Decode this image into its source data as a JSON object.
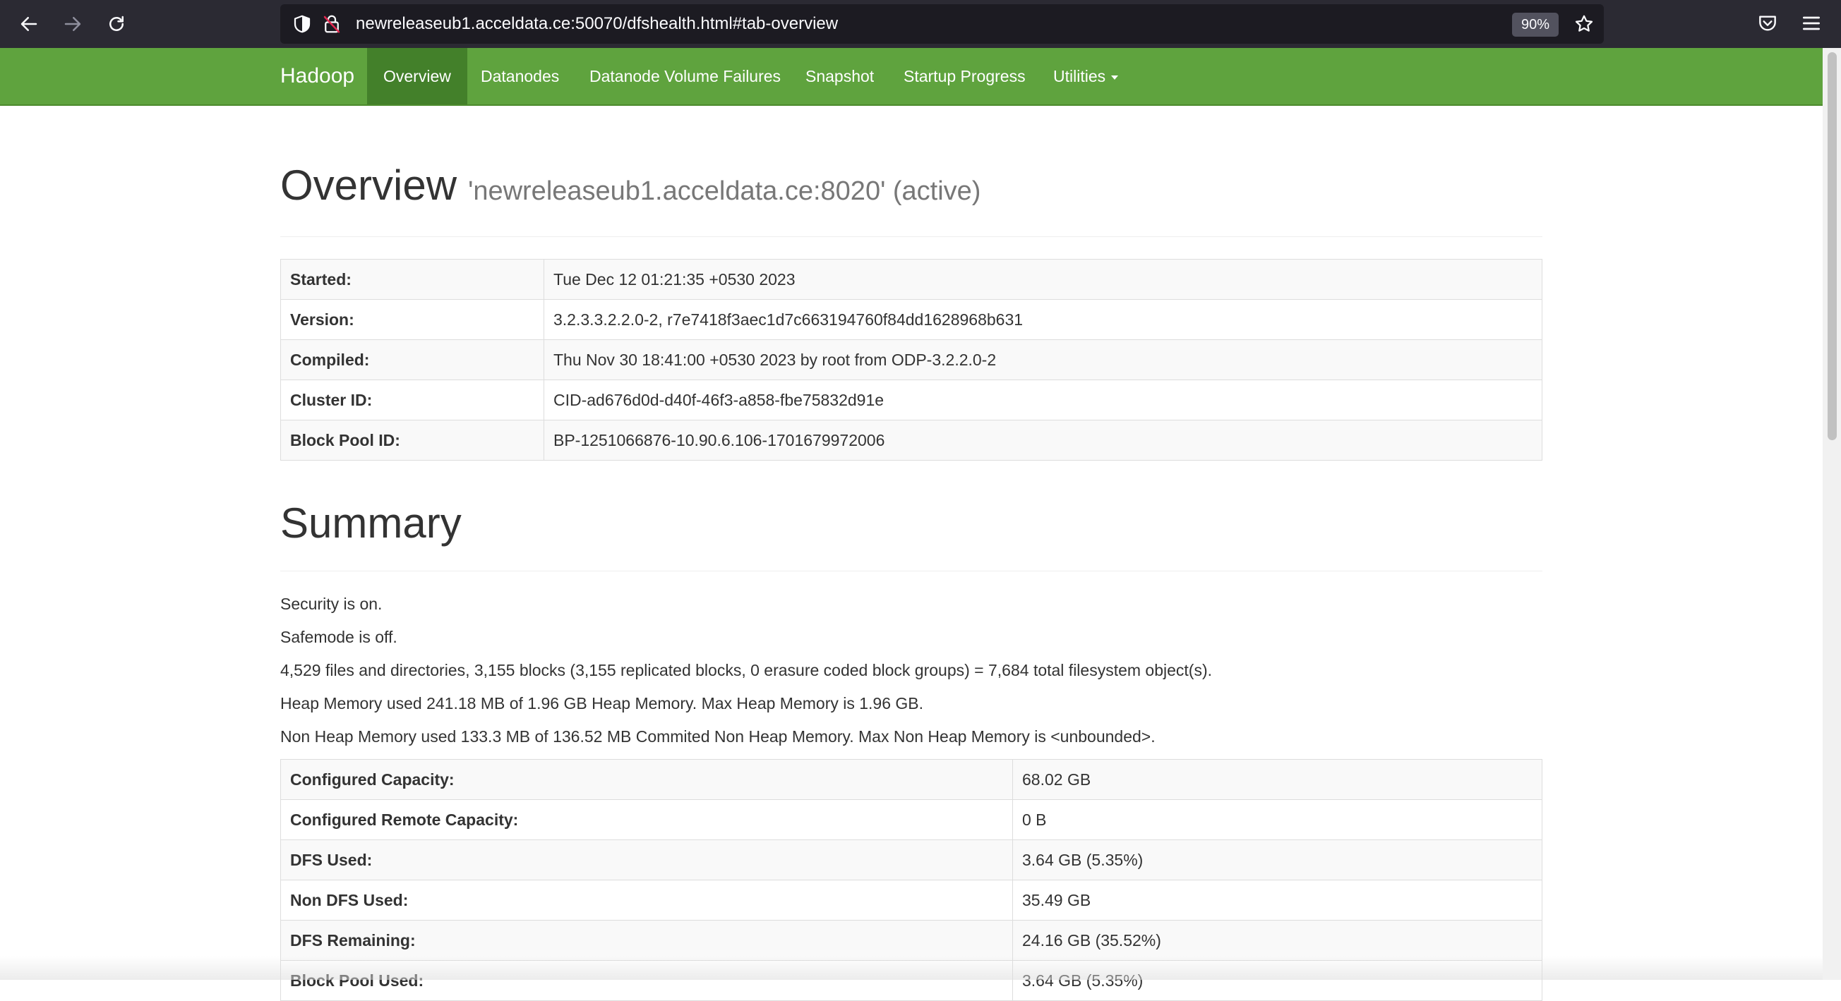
{
  "browser": {
    "url": "newreleaseub1.acceldata.ce:50070/dfshealth.html#tab-overview",
    "zoom": "90%"
  },
  "navbar": {
    "brand": "Hadoop",
    "items": [
      {
        "label": "Overview",
        "active": true
      },
      {
        "label": "Datanodes"
      },
      {
        "label": "Datanode Volume Failures"
      },
      {
        "label": "Snapshot"
      },
      {
        "label": "Startup Progress"
      },
      {
        "label": "Utilities"
      }
    ]
  },
  "overview": {
    "title": "Overview",
    "subtitle": "'newreleaseub1.acceldata.ce:8020' (active)",
    "rows": [
      {
        "key": "Started:",
        "value": "Tue Dec 12 01:21:35 +0530 2023"
      },
      {
        "key": "Version:",
        "value": "3.2.3.3.2.2.0-2, r7e7418f3aec1d7c663194760f84dd1628968b631"
      },
      {
        "key": "Compiled:",
        "value": "Thu Nov 30 18:41:00 +0530 2023 by root from ODP-3.2.2.0-2"
      },
      {
        "key": "Cluster ID:",
        "value": "CID-ad676d0d-d40f-46f3-a858-fbe75832d91e"
      },
      {
        "key": "Block Pool ID:",
        "value": "BP-1251066876-10.90.6.106-1701679972006"
      }
    ]
  },
  "summary": {
    "title": "Summary",
    "lines": [
      "Security is on.",
      "Safemode is off.",
      "4,529 files and directories, 3,155 blocks (3,155 replicated blocks, 0 erasure coded block groups) = 7,684 total filesystem object(s).",
      "Heap Memory used 241.18 MB of 1.96 GB Heap Memory. Max Heap Memory is 1.96 GB.",
      "Non Heap Memory used 133.3 MB of 136.52 MB Commited Non Heap Memory. Max Non Heap Memory is <unbounded>."
    ],
    "rows": [
      {
        "key": "Configured Capacity:",
        "value": "68.02 GB"
      },
      {
        "key": "Configured Remote Capacity:",
        "value": "0 B"
      },
      {
        "key": "DFS Used:",
        "value": "3.64 GB (5.35%)"
      },
      {
        "key": "Non DFS Used:",
        "value": "35.49 GB"
      },
      {
        "key": "DFS Remaining:",
        "value": "24.16 GB (35.52%)"
      },
      {
        "key": "Block Pool Used:",
        "value": "3.64 GB (5.35%)"
      }
    ]
  }
}
